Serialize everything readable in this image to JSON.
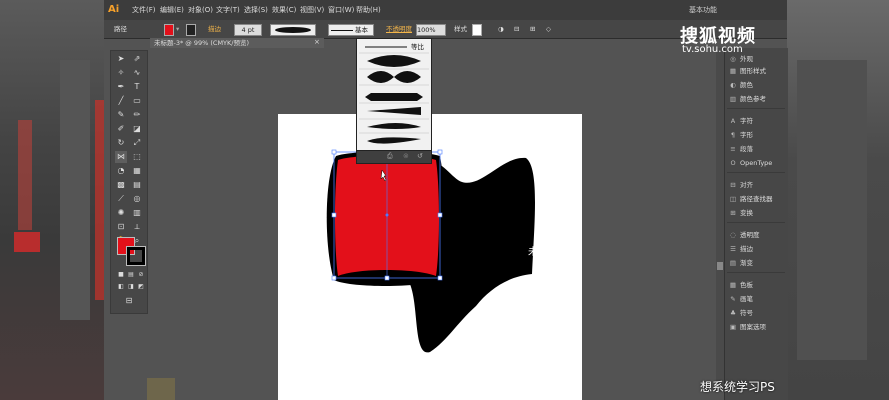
{
  "app": {
    "logo": "Ai",
    "menu": [
      "文件(F)",
      "编辑(E)",
      "对象(O)",
      "文字(T)",
      "选择(S)",
      "效果(C)",
      "视图(V)",
      "窗口(W)",
      "帮助(H)"
    ],
    "workspace": "基本功能"
  },
  "control_bar": {
    "object_label": "路径",
    "stroke_label": "描边",
    "stroke_width": "4 pt",
    "profile_label": "等比",
    "brush_label": "基本",
    "opacity_label": "不透明度",
    "opacity_value": "100%",
    "style_label": "样式"
  },
  "document": {
    "tab_title": "未标题-3* @ 99% (CMYK/预览)",
    "close": "×"
  },
  "brush_panel": {
    "top_label": "等比"
  },
  "dock": {
    "items": [
      {
        "icon": "appearance-icon",
        "glyph": "◎",
        "label": "外观"
      },
      {
        "icon": "graphic-styles-icon",
        "glyph": "▦",
        "label": "图形样式"
      },
      {
        "icon": "color-icon",
        "glyph": "◐",
        "label": "颜色"
      },
      {
        "icon": "color-guide-icon",
        "glyph": "▥",
        "label": "颜色参考"
      },
      {
        "icon": "character-icon",
        "glyph": "A",
        "label": "字符"
      },
      {
        "icon": "paragraph-icon",
        "glyph": "¶",
        "label": "字形"
      },
      {
        "icon": "paragraph-style-icon",
        "glyph": "≡",
        "label": "段落"
      },
      {
        "icon": "opentype-icon",
        "glyph": "O",
        "label": "OpenType"
      },
      {
        "icon": "align-icon",
        "glyph": "⊟",
        "label": "对齐"
      },
      {
        "icon": "pathfinder-icon",
        "glyph": "◫",
        "label": "路径查找器"
      },
      {
        "icon": "transform-icon",
        "glyph": "⊞",
        "label": "变换"
      },
      {
        "icon": "transparency-icon",
        "glyph": "◌",
        "label": "透明度"
      },
      {
        "icon": "stroke-icon",
        "glyph": "☰",
        "label": "描边"
      },
      {
        "icon": "gradient-icon",
        "glyph": "▤",
        "label": "渐变"
      },
      {
        "icon": "swatches-icon",
        "glyph": "▦",
        "label": "色板"
      },
      {
        "icon": "brushes-icon",
        "glyph": "✎",
        "label": "画笔"
      },
      {
        "icon": "symbols-icon",
        "glyph": "♣",
        "label": "符号"
      },
      {
        "icon": "graphic-styles-icon-2",
        "glyph": "▣",
        "label": "图案选项"
      }
    ]
  },
  "artwork": {
    "text": "未注册"
  },
  "colors": {
    "fill": "#e3101a",
    "stroke": "#000000",
    "accent": "#f7a12a"
  },
  "watermark": {
    "logo": "搜狐视频",
    "url": "tv.sohu.com",
    "caption": "想系统学习PS"
  }
}
